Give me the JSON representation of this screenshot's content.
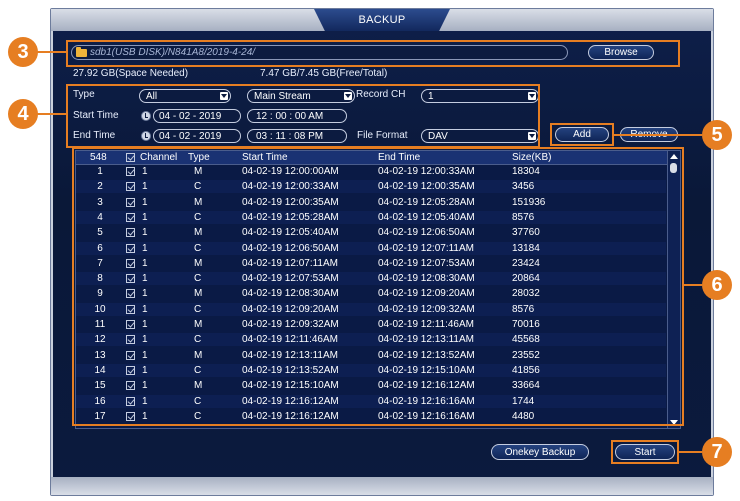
{
  "window": {
    "title": "BACKUP"
  },
  "path": {
    "text": "sdb1(USB DISK)/N841A8/2019-4-24/"
  },
  "buttons": {
    "browse": "Browse",
    "add": "Add",
    "remove": "Remove",
    "onekey_backup": "Onekey Backup",
    "start": "Start"
  },
  "space": {
    "needed": "27.92 GB(Space Needed)",
    "free_total": "7.47 GB/7.45 GB(Free/Total)"
  },
  "filters": {
    "type_label": "Type",
    "type_value": "All",
    "stream_value": "Main Stream",
    "record_ch_label": "Record CH",
    "record_ch_value": "1",
    "start_time_label": "Start Time",
    "start_date": "04 - 02 - 2019",
    "start_time": "12 : 00 : 00  AM",
    "end_time_label": "End Time",
    "end_date": "04 - 02 - 2019",
    "end_time": "03 : 11 : 08  PM",
    "file_format_label": "File Format",
    "file_format_value": "DAV"
  },
  "callouts": [
    "3",
    "4",
    "5",
    "6",
    "7"
  ],
  "table": {
    "count": "548",
    "headers": {
      "channel": "Channel",
      "type": "Type",
      "start": "Start Time",
      "end": "End Time",
      "size": "Size(KB)"
    },
    "rows": [
      {
        "n": "1",
        "ch": "1",
        "type": "M",
        "start": "04-02-19 12:00:00AM",
        "end": "04-02-19 12:00:33AM",
        "size": "18304"
      },
      {
        "n": "2",
        "ch": "1",
        "type": "C",
        "start": "04-02-19 12:00:33AM",
        "end": "04-02-19 12:00:35AM",
        "size": "3456"
      },
      {
        "n": "3",
        "ch": "1",
        "type": "M",
        "start": "04-02-19 12:00:35AM",
        "end": "04-02-19 12:05:28AM",
        "size": "151936"
      },
      {
        "n": "4",
        "ch": "1",
        "type": "C",
        "start": "04-02-19 12:05:28AM",
        "end": "04-02-19 12:05:40AM",
        "size": "8576"
      },
      {
        "n": "5",
        "ch": "1",
        "type": "M",
        "start": "04-02-19 12:05:40AM",
        "end": "04-02-19 12:06:50AM",
        "size": "37760"
      },
      {
        "n": "6",
        "ch": "1",
        "type": "C",
        "start": "04-02-19 12:06:50AM",
        "end": "04-02-19 12:07:11AM",
        "size": "13184"
      },
      {
        "n": "7",
        "ch": "1",
        "type": "M",
        "start": "04-02-19 12:07:11AM",
        "end": "04-02-19 12:07:53AM",
        "size": "23424"
      },
      {
        "n": "8",
        "ch": "1",
        "type": "C",
        "start": "04-02-19 12:07:53AM",
        "end": "04-02-19 12:08:30AM",
        "size": "20864"
      },
      {
        "n": "9",
        "ch": "1",
        "type": "M",
        "start": "04-02-19 12:08:30AM",
        "end": "04-02-19 12:09:20AM",
        "size": "28032"
      },
      {
        "n": "10",
        "ch": "1",
        "type": "C",
        "start": "04-02-19 12:09:20AM",
        "end": "04-02-19 12:09:32AM",
        "size": "8576"
      },
      {
        "n": "11",
        "ch": "1",
        "type": "M",
        "start": "04-02-19 12:09:32AM",
        "end": "04-02-19 12:11:46AM",
        "size": "70016"
      },
      {
        "n": "12",
        "ch": "1",
        "type": "C",
        "start": "04-02-19 12:11:46AM",
        "end": "04-02-19 12:13:11AM",
        "size": "45568"
      },
      {
        "n": "13",
        "ch": "1",
        "type": "M",
        "start": "04-02-19 12:13:11AM",
        "end": "04-02-19 12:13:52AM",
        "size": "23552"
      },
      {
        "n": "14",
        "ch": "1",
        "type": "C",
        "start": "04-02-19 12:13:52AM",
        "end": "04-02-19 12:15:10AM",
        "size": "41856"
      },
      {
        "n": "15",
        "ch": "1",
        "type": "M",
        "start": "04-02-19 12:15:10AM",
        "end": "04-02-19 12:16:12AM",
        "size": "33664"
      },
      {
        "n": "16",
        "ch": "1",
        "type": "C",
        "start": "04-02-19 12:16:12AM",
        "end": "04-02-19 12:16:16AM",
        "size": "1744"
      },
      {
        "n": "17",
        "ch": "1",
        "type": "C",
        "start": "04-02-19 12:16:12AM",
        "end": "04-02-19 12:16:16AM",
        "size": "4480"
      }
    ]
  },
  "colors": {
    "callout": "#e67e22",
    "panel_bg": "#0a1838",
    "header_bg": "#1a3273"
  }
}
